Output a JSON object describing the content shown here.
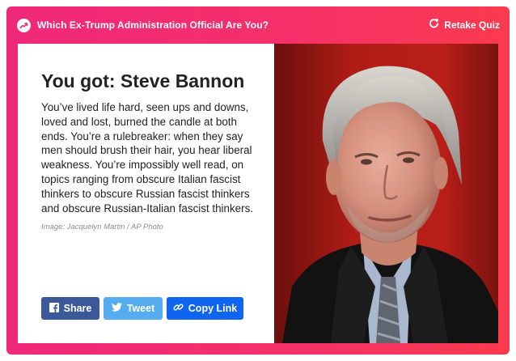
{
  "header": {
    "quiz_title": "Which Ex-Trump Administration Official Are You?",
    "retake_label": "Retake Quiz"
  },
  "result": {
    "title": "You got: Steve Bannon",
    "description": "You’ve lived life hard, seen ups and downs, loved and lost, burned the candle at both ends. You’re a rulebreaker: when they say men should brush their hair, you hear liberal weakness. You’re impossibly well read, on topics ranging from obscure Italian fascist thinkers to obscure Russian fascist thinkers and obscure Russian-Italian fascist thinkers.",
    "image_credit": "Image: Jacquelyn Martin / AP Photo"
  },
  "share": {
    "facebook_label": "Share",
    "twitter_label": "Tweet",
    "copy_link_label": "Copy Link"
  },
  "icons": {
    "trending": "trending-icon",
    "retake": "refresh-icon",
    "facebook": "facebook-icon",
    "twitter": "twitter-icon",
    "link": "link-icon"
  },
  "colors": {
    "gradient_start": "#f0287a",
    "gradient_end": "#fa3a4e",
    "facebook": "#3b5998",
    "twitter": "#55acee",
    "copy_link": "#0f65ef"
  }
}
